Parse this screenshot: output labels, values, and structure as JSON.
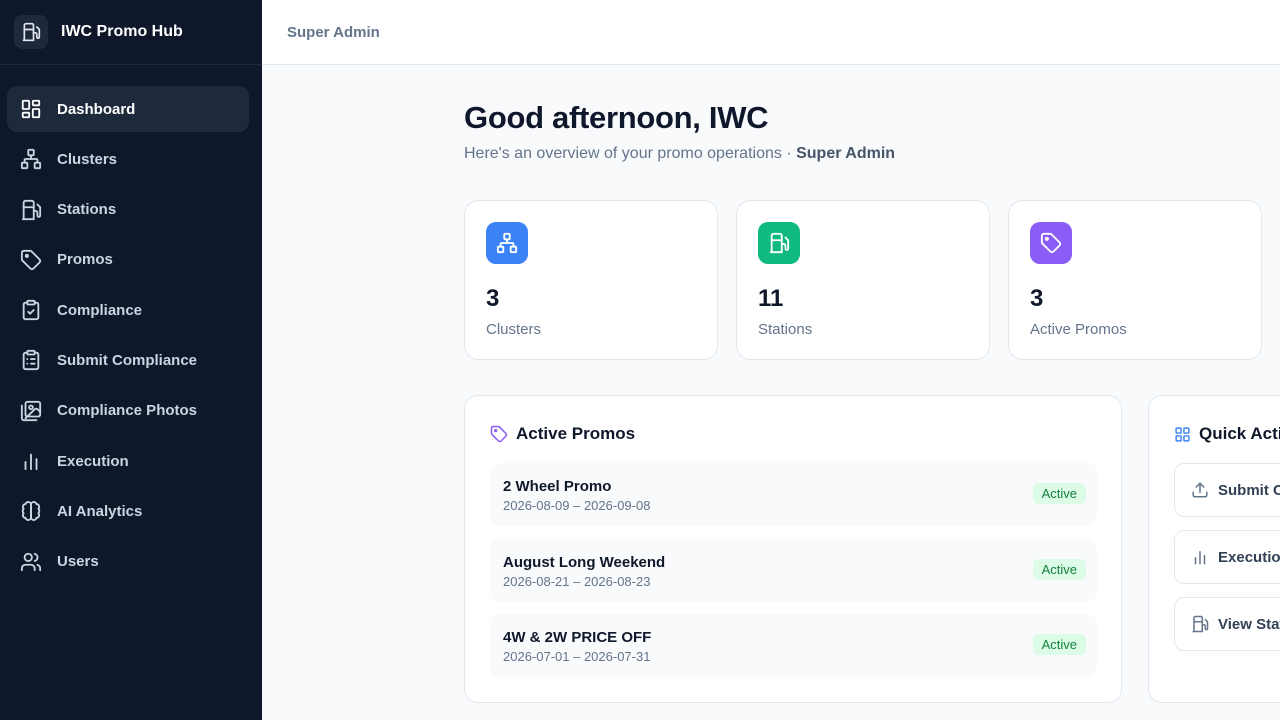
{
  "app": {
    "title": "IWC Promo Hub"
  },
  "sidebar": {
    "items": [
      {
        "label": "Dashboard",
        "icon": "dashboard-icon"
      },
      {
        "label": "Clusters",
        "icon": "cluster-icon"
      },
      {
        "label": "Stations",
        "icon": "fuel-pump-icon"
      },
      {
        "label": "Promos",
        "icon": "tag-icon"
      },
      {
        "label": "Compliance",
        "icon": "clipboard-check-icon"
      },
      {
        "label": "Submit Compliance",
        "icon": "clipboard-list-icon"
      },
      {
        "label": "Compliance Photos",
        "icon": "images-icon"
      },
      {
        "label": "Execution",
        "icon": "bar-chart-icon"
      },
      {
        "label": "AI Analytics",
        "icon": "brain-icon"
      },
      {
        "label": "Users",
        "icon": "users-icon"
      }
    ]
  },
  "topbar": {
    "role": "Super Admin"
  },
  "main": {
    "greeting": "Good afternoon, IWC",
    "subtitle_text": "Here's an overview of your promo operations · ",
    "subtitle_role": "Super Admin"
  },
  "stats": [
    {
      "value": "3",
      "label": "Clusters",
      "color": "#3b82f6",
      "icon": "cluster-icon"
    },
    {
      "value": "11",
      "label": "Stations",
      "color": "#10b981",
      "icon": "fuel-pump-icon"
    },
    {
      "value": "3",
      "label": "Active Promos",
      "color": "#8b5cf6",
      "icon": "tag-icon"
    }
  ],
  "active_promos": {
    "title": "Active Promos",
    "items": [
      {
        "name": "2 Wheel Promo",
        "dates": "2026-08-09 – 2026-09-08",
        "status": "Active"
      },
      {
        "name": "August Long Weekend",
        "dates": "2026-08-21 – 2026-08-23",
        "status": "Active"
      },
      {
        "name": "4W & 2W PRICE OFF",
        "dates": "2026-07-01 – 2026-07-31",
        "status": "Active"
      }
    ]
  },
  "quick_actions": {
    "title": "Quick Acti",
    "items": [
      {
        "label": "Submit C",
        "icon": "upload-icon"
      },
      {
        "label": "Execution",
        "icon": "bar-chart-icon"
      },
      {
        "label": "View Stat",
        "icon": "fuel-pump-icon"
      }
    ]
  },
  "colors": {
    "sidebar_bg": "#0f172a",
    "badge_bg": "#dcfce7",
    "badge_text": "#15803d"
  }
}
